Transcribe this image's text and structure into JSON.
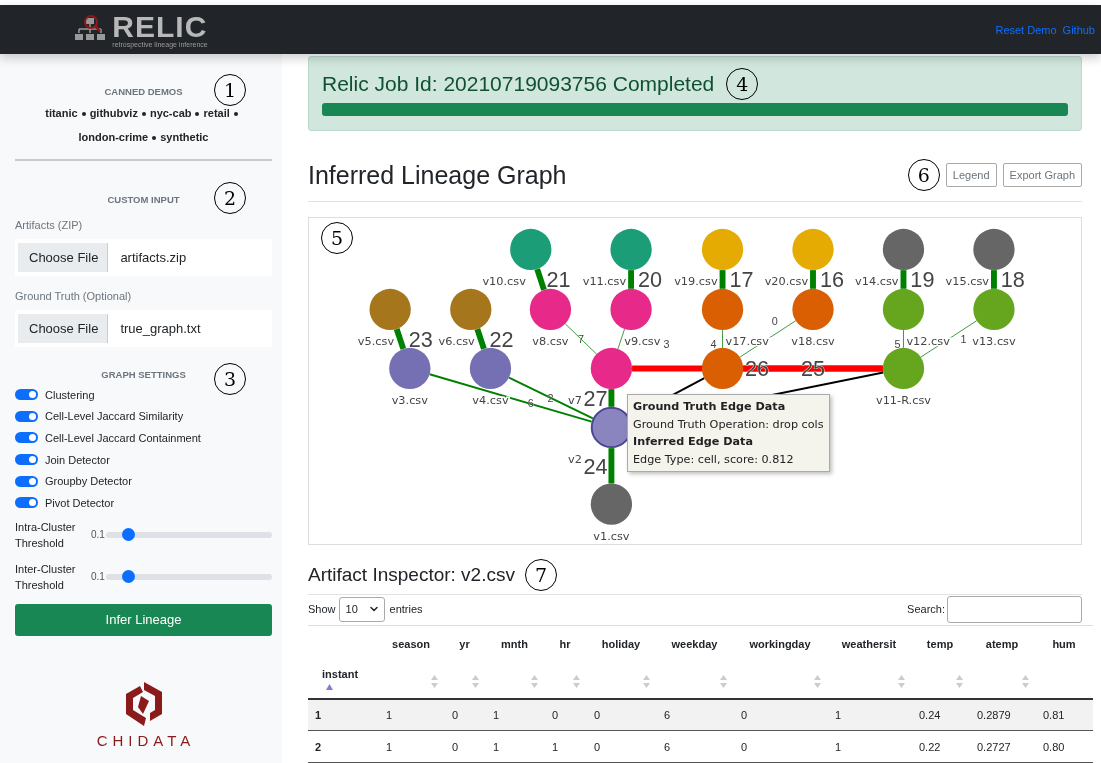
{
  "header": {
    "logo": {
      "title": "RELIC",
      "subtitle": "retrospective lineage inference"
    },
    "links": [
      "Reset Demo",
      "Github"
    ]
  },
  "sidebar": {
    "canned_demos": {
      "heading": "CANNED DEMOS",
      "callout": "1",
      "demos": [
        "titanic",
        "githubviz",
        "nyc-cab",
        "retail",
        "london-crime",
        "synthetic"
      ]
    },
    "custom_input": {
      "heading": "CUSTOM INPUT",
      "callout": "2",
      "fields": [
        {
          "label": "Artifacts (ZIP)",
          "button": "Choose File",
          "value": "artifacts.zip"
        },
        {
          "label": "Ground Truth (Optional)",
          "button": "Choose File",
          "value": "true_graph.txt"
        }
      ]
    },
    "graph_settings": {
      "heading": "GRAPH SETTINGS",
      "callout": "3",
      "toggles": [
        {
          "label": "Clustering",
          "on": true
        },
        {
          "label": "Cell-Level Jaccard Similarity",
          "on": true
        },
        {
          "label": "Cell-Level Jaccard Containment",
          "on": true
        },
        {
          "label": "Join Detector",
          "on": true
        },
        {
          "label": "Groupby Detector",
          "on": true
        },
        {
          "label": "Pivot Detector",
          "on": true
        }
      ],
      "sliders": [
        {
          "label": "Intra-Cluster Threshold",
          "reading": "0.1",
          "level": 0.1
        },
        {
          "label": "Inter-Cluster Threshold",
          "reading": "0.1",
          "level": 0.1
        }
      ]
    },
    "infer_button": "Infer Lineage",
    "footer_logo": "CHIDATA"
  },
  "job": {
    "title": "Relic Job Id: 20210719093756 Completed",
    "callout": "4",
    "level": 1
  },
  "graph": {
    "title": "Inferred Lineage Graph",
    "callout": "6",
    "buttons": [
      "Legend",
      "Export Graph"
    ],
    "canvas_callout": "5",
    "nodes": [
      {
        "label": "v10.csv",
        "color": "#1b9e77",
        "selected": false
      },
      {
        "label": "v11.csv",
        "color": "#1b9e77",
        "selected": false
      },
      {
        "label": "v19.csv",
        "color": "#e6ab02",
        "selected": false
      },
      {
        "label": "v20.csv",
        "color": "#e6ab02",
        "selected": false
      },
      {
        "label": "v14.csv",
        "color": "#666666",
        "selected": false
      },
      {
        "label": "v15.csv",
        "color": "#666666",
        "selected": false
      },
      {
        "label": "v5.csv",
        "color": "#a6761d",
        "selected": false
      },
      {
        "label": "v6.csv",
        "color": "#a6761d",
        "selected": false
      },
      {
        "label": "v8.csv",
        "color": "#e7298a",
        "selected": false
      },
      {
        "label": "v9.csv",
        "color": "#e7298a",
        "selected": false
      },
      {
        "label": "v17.csv",
        "color": "#d95f02",
        "selected": false
      },
      {
        "label": "v18.csv",
        "color": "#d95f02",
        "selected": false
      },
      {
        "label": "v12.csv",
        "color": "#66a61e",
        "selected": false
      },
      {
        "label": "v13.csv",
        "color": "#66a61e",
        "selected": false
      },
      {
        "label": "v3.csv",
        "color": "#7570b3",
        "selected": false
      },
      {
        "label": "v4.csv",
        "color": "#7570b3",
        "selected": false
      },
      {
        "label": "v7",
        "color": "#e7298a",
        "selected": false
      },
      {
        "color": "#d95f02",
        "selected": false
      },
      {
        "label": "v11-R.csv",
        "color": "#66a61e",
        "selected": false
      },
      {
        "label": "v2",
        "color": "#7570b3",
        "selected": true
      },
      {
        "label": "v1.csv",
        "color": "#666666",
        "selected": false
      }
    ],
    "edges": [
      {
        "label": "21",
        "kind": "strong"
      },
      {
        "label": "20",
        "kind": "strong"
      },
      {
        "label": "17",
        "kind": "strong"
      },
      {
        "label": "16",
        "kind": "strong"
      },
      {
        "label": "19",
        "kind": "strong"
      },
      {
        "label": "18",
        "kind": "strong"
      },
      {
        "label": "23",
        "kind": "strong"
      },
      {
        "label": "22",
        "kind": "strong"
      },
      {
        "label": "7",
        "kind": "weak"
      },
      {
        "label": "3",
        "kind": "weak"
      },
      {
        "label": "4",
        "kind": "weak"
      },
      {
        "label": "0",
        "kind": "weak"
      },
      {
        "label": "5",
        "kind": "weak"
      },
      {
        "label": "1",
        "kind": "weak"
      },
      {
        "label": "6",
        "kind": "medium"
      },
      {
        "label": "2",
        "kind": "medium"
      },
      {
        "label": "27",
        "kind": "strong"
      },
      {
        "label": "24",
        "kind": "strong"
      },
      {
        "label": "26",
        "kind": "missing"
      },
      {
        "label": "25",
        "kind": "missing"
      },
      {
        "kind": "extra"
      },
      {
        "kind": "extra"
      }
    ],
    "tooltip": [
      {
        "text": "Ground Truth Edge Data",
        "kind": "heading"
      },
      {
        "text": "Ground Truth Operation: drop cols",
        "kind": "line"
      },
      {
        "text": "Inferred Edge Data",
        "kind": "heading"
      },
      {
        "text": "Edge Type: cell, score: 0.812",
        "kind": "line"
      }
    ]
  },
  "inspector": {
    "title": "Artifact Inspector: v2.csv",
    "callout": "7",
    "show_label": "Show",
    "page_size": "10",
    "entries_label": "entries",
    "search_label": "Search:",
    "columns": [
      {
        "label": "instant",
        "selected": true
      },
      {
        "label": "season",
        "selected": false
      },
      {
        "label": "yr",
        "selected": false
      },
      {
        "label": "mnth",
        "selected": false
      },
      {
        "label": "hr",
        "selected": false
      },
      {
        "label": "holiday",
        "selected": false
      },
      {
        "label": "weekday",
        "selected": false
      },
      {
        "label": "workingday",
        "selected": false
      },
      {
        "label": "weathersit",
        "selected": false
      },
      {
        "label": "temp",
        "selected": false
      },
      {
        "label": "atemp",
        "selected": false
      },
      {
        "label": "hum",
        "selected": false
      }
    ],
    "rows": [
      [
        "1",
        "1",
        "0",
        "1",
        "0",
        "0",
        "6",
        "0",
        "1",
        "0.24",
        "0.2879",
        "0.81"
      ],
      [
        "2",
        "1",
        "0",
        "1",
        "1",
        "0",
        "6",
        "0",
        "1",
        "0.22",
        "0.2727",
        "0.80"
      ]
    ]
  }
}
